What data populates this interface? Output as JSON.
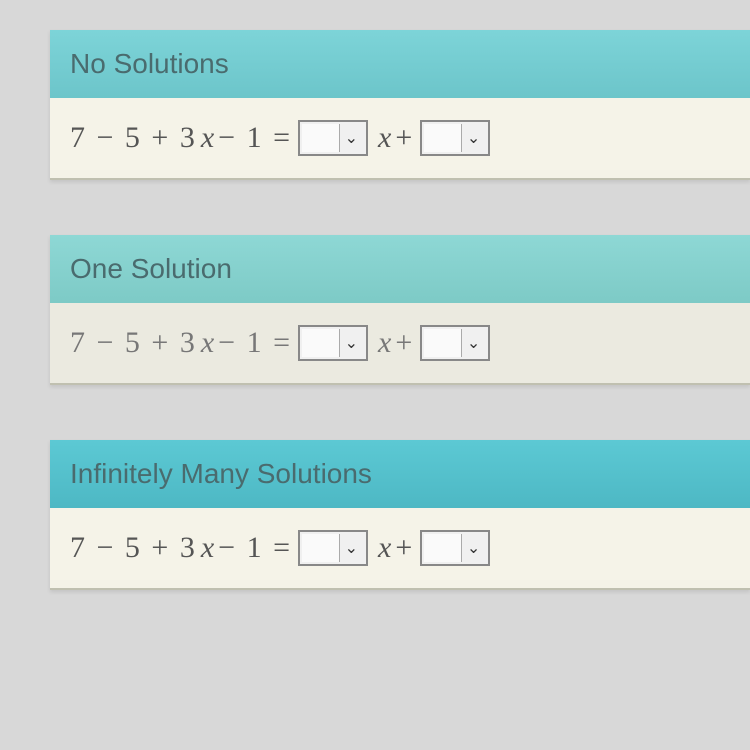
{
  "sections": [
    {
      "title": "No Solutions",
      "equation_left": "7 − 5 + 3",
      "equation_var1": "x",
      "equation_mid": " − 1 = ",
      "equation_var2": "x",
      "equation_plus": " + "
    },
    {
      "title": "One Solution",
      "equation_left": "7 − 5 + 3",
      "equation_var1": "x",
      "equation_mid": " − 1 = ",
      "equation_var2": "x",
      "equation_plus": " + "
    },
    {
      "title": "Infinitely Many Solutions",
      "equation_left": "7 − 5 + 3",
      "equation_var1": "x",
      "equation_mid": " − 1 = ",
      "equation_var2": "x",
      "equation_plus": " + "
    }
  ],
  "chevron": "⌄"
}
